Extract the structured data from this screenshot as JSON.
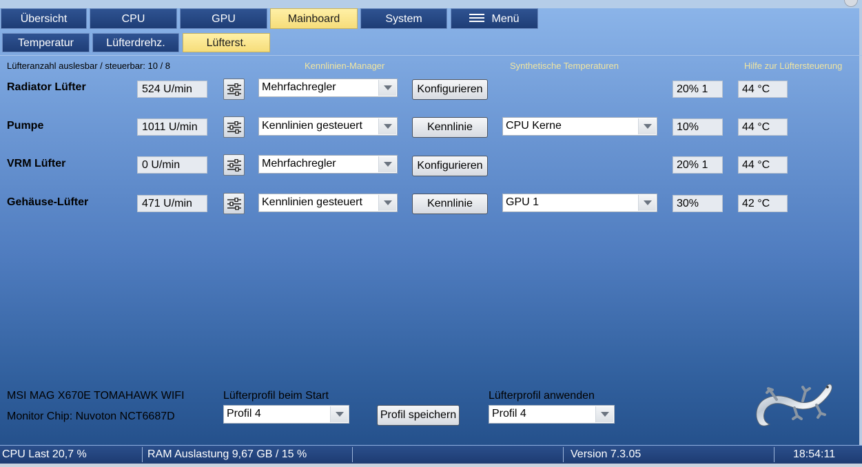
{
  "tabs": [
    {
      "label": "Übersicht"
    },
    {
      "label": "CPU"
    },
    {
      "label": "GPU"
    },
    {
      "label": "Mainboard"
    },
    {
      "label": "System"
    },
    {
      "label": "Menü"
    }
  ],
  "active_tab": "Mainboard",
  "subtabs": [
    {
      "label": "Temperatur"
    },
    {
      "label": "Lüfterdrehz."
    },
    {
      "label": "Lüfterst."
    }
  ],
  "active_subtab": "Lüfterst.",
  "header": {
    "fan_count": "Lüfteranzahl auslesbar / steuerbar: 10 / 8",
    "curve_manager": "Kennlinien-Manager",
    "synthetic_temps": "Synthetische Temperaturen",
    "help": "Hilfe zur Lüftersteuerung"
  },
  "fans": [
    {
      "name": "Radiator Lüfter",
      "rpm": "524 U/min",
      "mode": "Mehrfachregler",
      "action": "Konfigurieren",
      "source": "",
      "percent": "20% 1",
      "temp": "44 °C"
    },
    {
      "name": "Pumpe",
      "rpm": "1011 U/min",
      "mode": "Kennlinien gesteuert",
      "action": "Kennlinie",
      "source": "CPU Kerne",
      "percent": "10%",
      "temp": "44 °C"
    },
    {
      "name": "VRM Lüfter",
      "rpm": "0 U/min",
      "mode": "Mehrfachregler",
      "action": "Konfigurieren",
      "source": "",
      "percent": "20% 1",
      "temp": "44 °C"
    },
    {
      "name": "Gehäuse-Lüfter",
      "rpm": "471 U/min",
      "mode": "Kennlinien gesteuert",
      "action": "Kennlinie",
      "source": "GPU 1",
      "percent": "30%",
      "temp": "42 °C"
    }
  ],
  "footer": {
    "board": "MSI MAG X670E TOMAHAWK WIFI",
    "chip": "Monitor Chip: Nuvoton NCT6687D",
    "profile_start_label": "Lüfterprofil beim Start",
    "profile_start_value": "Profil 4",
    "save_profile": "Profil speichern",
    "profile_apply_label": "Lüfterprofil anwenden",
    "profile_apply_value": "Profil 4"
  },
  "status": {
    "cpu_load": "CPU Last 20,7 %",
    "ram": "RAM Auslastung 9,67 GB / 15 %",
    "version": "Version 7.3.05",
    "time": "18:54:11"
  }
}
